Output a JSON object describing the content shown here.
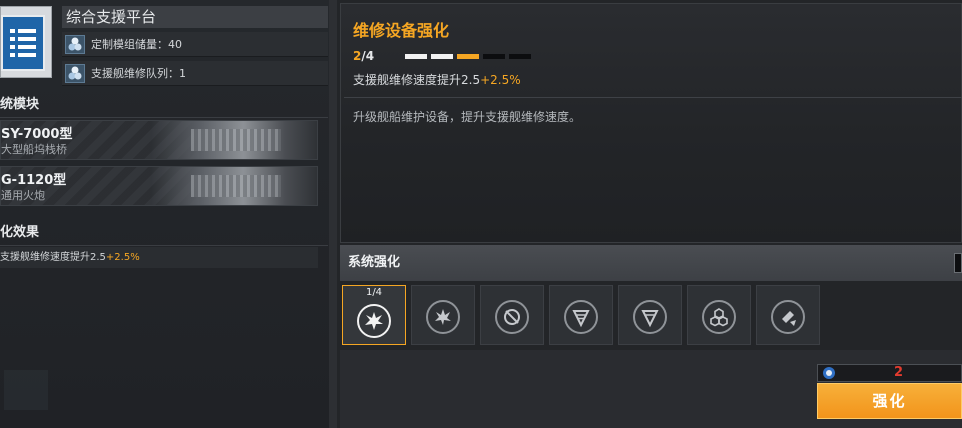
{
  "left": {
    "platform_title": "综合支援平台",
    "stats": [
      {
        "label": "定制模组储量：40",
        "icon": "module-storage-icon"
      },
      {
        "label": "支援舰维修队列：1",
        "icon": "repair-queue-icon"
      }
    ],
    "modules_heading": "统模块",
    "modules": [
      {
        "name": "SY-7000型",
        "desc": "大型船坞栈桥"
      },
      {
        "name": "G-1120型",
        "desc": "通用火炮"
      }
    ],
    "effects_heading": "化效果",
    "effect": {
      "text": "支援舰维修速度提升2.5",
      "bonus": "+2.5%"
    }
  },
  "detail": {
    "title": "维修设备强化",
    "level_current": "2",
    "level_total": "/4",
    "pips": [
      "on",
      "on",
      "next",
      "off",
      "off"
    ],
    "stat": {
      "text": "支援舰维修速度提升2.5",
      "bonus": "+2.5%"
    },
    "description": "升级舰船维护设备，提升支援舰维修速度。"
  },
  "system": {
    "heading": "系统强化",
    "slots": [
      {
        "level": "1/4",
        "icon": "explosion-icon",
        "active": true
      },
      {
        "level": "",
        "icon": "blast-icon",
        "active": false
      },
      {
        "level": "",
        "icon": "hazard-icon",
        "active": false
      },
      {
        "level": "",
        "icon": "drill-icon",
        "active": false
      },
      {
        "level": "",
        "icon": "drill-alt-icon",
        "active": false
      },
      {
        "level": "",
        "icon": "cluster-icon",
        "active": false
      },
      {
        "level": "",
        "icon": "rocket-icon",
        "active": false
      }
    ]
  },
  "action": {
    "cost_count": "2",
    "enhance_label": "强化"
  },
  "colors": {
    "accent": "#f5a623",
    "panel": "#232528",
    "cost_red": "#e23b2e"
  }
}
